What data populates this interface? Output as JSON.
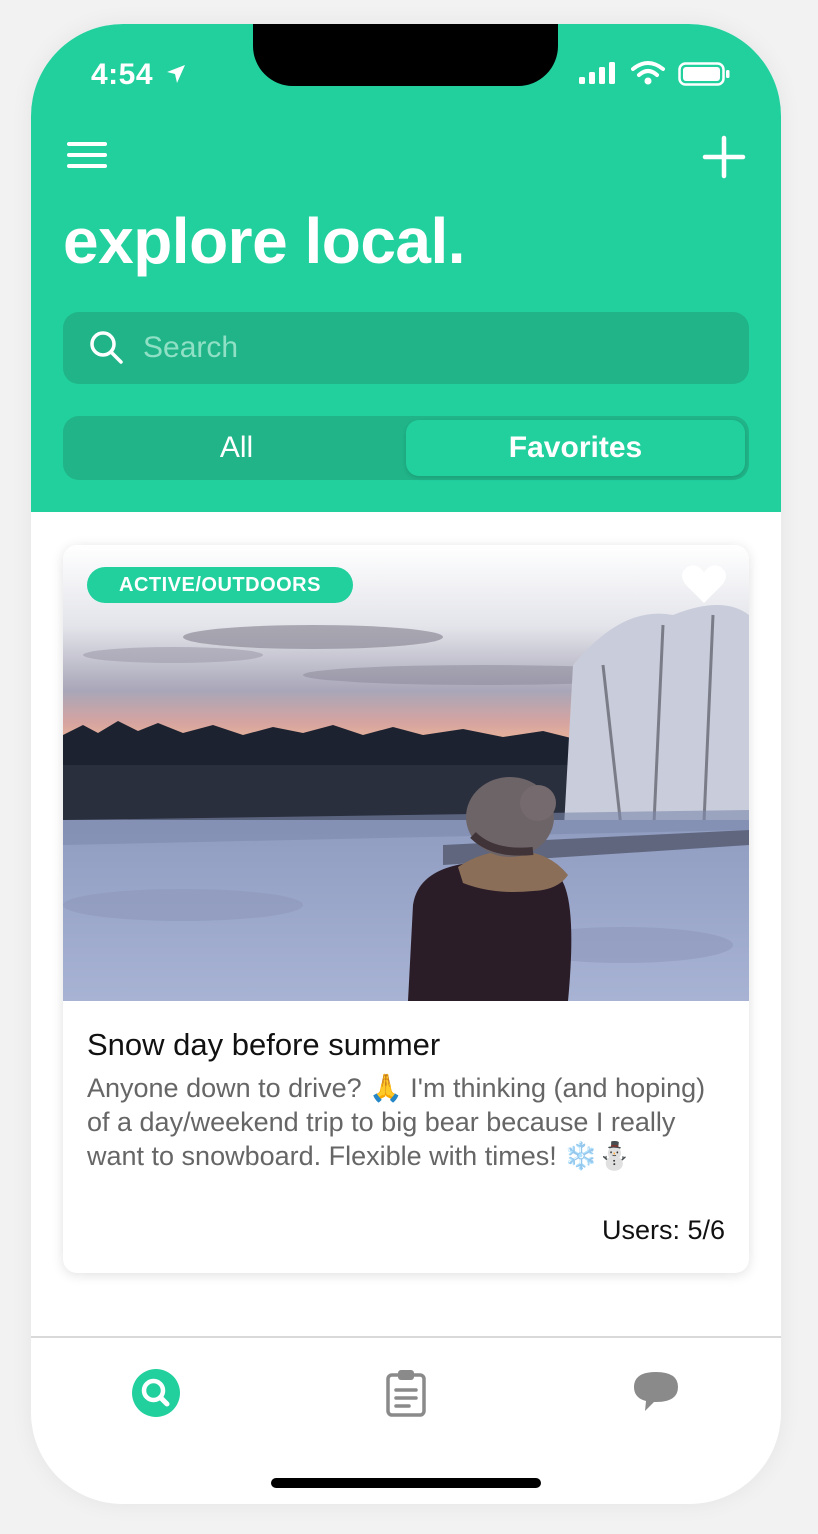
{
  "status_bar": {
    "time": "4:54",
    "icons": [
      "location-arrow-icon",
      "signal-icon",
      "wifi-icon",
      "battery-icon"
    ]
  },
  "header": {
    "menu_icon": "hamburger-menu-icon",
    "add_icon": "plus-icon",
    "title": "explore local.",
    "background_color": "#22d09e"
  },
  "search": {
    "placeholder": "Search",
    "value": ""
  },
  "segments": {
    "items": [
      "All",
      "Favorites"
    ],
    "selected": "Favorites"
  },
  "card": {
    "category": "ACTIVE/OUTDOORS",
    "title": "Snow day before summer",
    "description": "Anyone down to drive? 🙏 I'm thinking (and hoping) of a day/weekend trip to big bear because I really want to snowboard. Flexible with times! ❄️⛄",
    "users": "Users: 5/6",
    "favorite_icon": "heart-icon"
  },
  "tab_bar": {
    "tabs": [
      {
        "icon": "search-icon",
        "active": true
      },
      {
        "icon": "clipboard-icon",
        "active": false
      },
      {
        "icon": "chat-bubble-icon",
        "active": false
      }
    ],
    "active_color": "#22d09e",
    "inactive_color": "#8a8a8a"
  }
}
